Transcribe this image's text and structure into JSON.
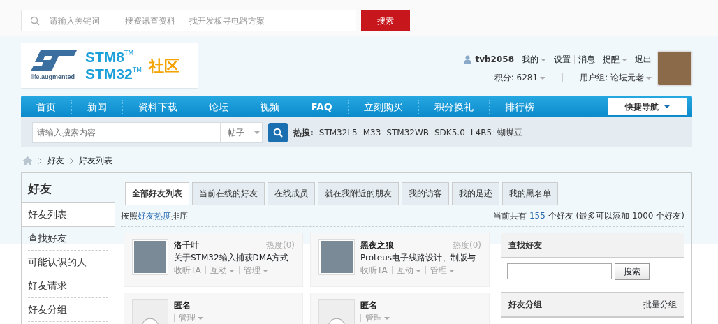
{
  "top_search": {
    "placeholder": "请输入关键词",
    "hints": [
      "搜资讯查资料",
      "找开发板寻电路方案"
    ],
    "button": "搜索"
  },
  "logo": {
    "tagline_a": "life.",
    "tagline_b": "augmented",
    "line1": "STM8",
    "line2": "STM32",
    "tm1": "TM",
    "tm2": "TM",
    "community": "社区"
  },
  "user": {
    "name": "tvb2058",
    "menu": [
      {
        "label": "我的",
        "caret": true
      },
      {
        "label": "设置",
        "caret": false
      },
      {
        "label": "消息",
        "caret": false
      },
      {
        "label": "提醒",
        "caret": true
      },
      {
        "label": "退出",
        "caret": false
      }
    ],
    "points": "积分: 6281",
    "group": "用户组: 论坛元老"
  },
  "nav": {
    "items": [
      "首页",
      "新闻",
      "资料下载",
      "论坛",
      "视频",
      "FAQ",
      "立刻购买",
      "积分换礼",
      "排行榜"
    ],
    "quick": "快捷导航"
  },
  "search": {
    "placeholder": "请输入搜索内容",
    "type": "帖子",
    "hot_label": "热搜:",
    "hot": [
      "STM32L5",
      "M33",
      "STM32WB",
      "SDK5.0",
      "L4R5",
      "蝴蝶豆"
    ]
  },
  "breadcrumb": [
    "好友",
    "好友列表"
  ],
  "sidebar": {
    "title": "好友",
    "items": [
      {
        "label": "好友列表",
        "selected": true
      },
      {
        "label": "查找好友",
        "selected": false
      },
      {
        "label": "可能认识的人",
        "selected": false
      },
      {
        "label": "好友请求",
        "selected": false
      },
      {
        "label": "好友分组",
        "selected": false
      }
    ]
  },
  "tabs": [
    {
      "label": "全部好友列表",
      "selected": true
    },
    {
      "label": "当前在线的好友",
      "selected": false
    },
    {
      "label": "在线成员",
      "selected": false
    },
    {
      "label": "就在我附近的朋友",
      "selected": false
    },
    {
      "label": "我的访客",
      "selected": false
    },
    {
      "label": "我的足迹",
      "selected": false
    },
    {
      "label": "我的黑名单",
      "selected": false
    }
  ],
  "sort": {
    "before": "按照",
    "link": "好友热度",
    "after": "排序"
  },
  "count": "当前共有 **155** 个好友 (最多可以添加 1000 个好友)",
  "friends": [
    {
      "name": "洛千叶",
      "kind": "photo",
      "heat": "热度(0)",
      "status": "关于STM32输入捕获DMA方式",
      "actions": [
        {
          "label": "收听TA",
          "caret": false
        },
        {
          "label": "互动",
          "caret": true
        },
        {
          "label": "管理",
          "caret": true
        }
      ]
    },
    {
      "name": "黑夜之狼",
      "kind": "photo",
      "heat": "热度(0)",
      "status": "Proteus电子线路设计、制版与",
      "actions": [
        {
          "label": "收听TA",
          "caret": false
        },
        {
          "label": "互动",
          "caret": true
        },
        {
          "label": "管理",
          "caret": true
        }
      ]
    },
    {
      "name": "匿名",
      "kind": "anonymous",
      "actions": [
        {
          "label": "管理",
          "caret": true
        }
      ]
    },
    {
      "name": "匿名",
      "kind": "anonymous",
      "actions": [
        {
          "label": "管理",
          "caret": true
        }
      ]
    }
  ],
  "find_panel": {
    "title": "查找好友",
    "button": "搜索"
  },
  "group_panel": {
    "title": "好友分组",
    "link": "批量分组"
  }
}
